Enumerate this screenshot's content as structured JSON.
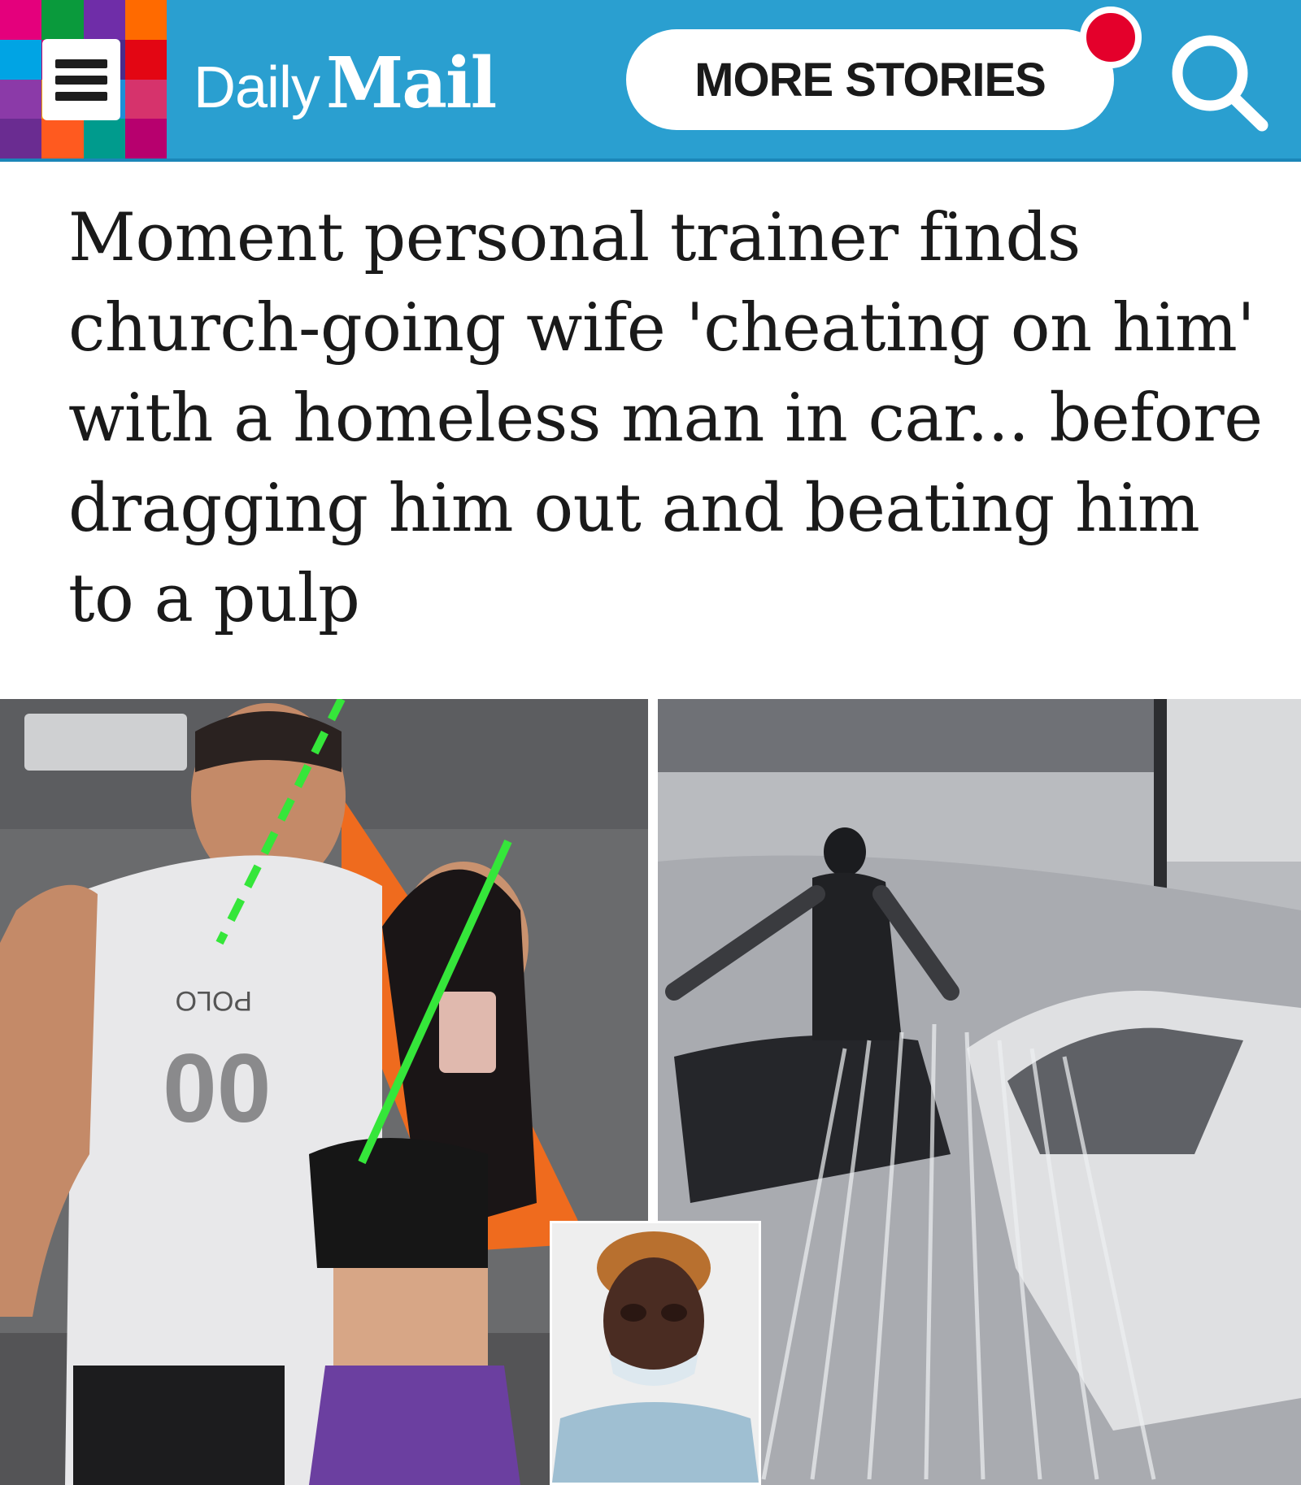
{
  "header": {
    "brand_daily": "Daily",
    "brand_mail": "Mail",
    "more_stories_label": "MORE STORIES",
    "menu_icon": "hamburger-menu-icon",
    "search_icon": "search-icon",
    "accent_color": "#2a9fd0",
    "notification_color": "#e4002b",
    "menu_tile_colors": [
      "#e4007c",
      "#0a9a3c",
      "#6f2da8",
      "#ff6a00",
      "#00a4e4",
      "#c8006e",
      "#4a2c8a",
      "#e30613",
      "#8b3aa8",
      "#f4a300",
      "#1e8fd8",
      "#d6336c",
      "#6a2c91",
      "#ff5a1f",
      "#009b8d",
      "#b7006e"
    ]
  },
  "article": {
    "headline": "Moment personal trainer finds church-going wife 'cheating on him' with a homeless man in car... before dragging him out and beating him to a pulp"
  },
  "images": {
    "left": {
      "shirt_text": "POLO",
      "shirt_number": "00"
    }
  }
}
